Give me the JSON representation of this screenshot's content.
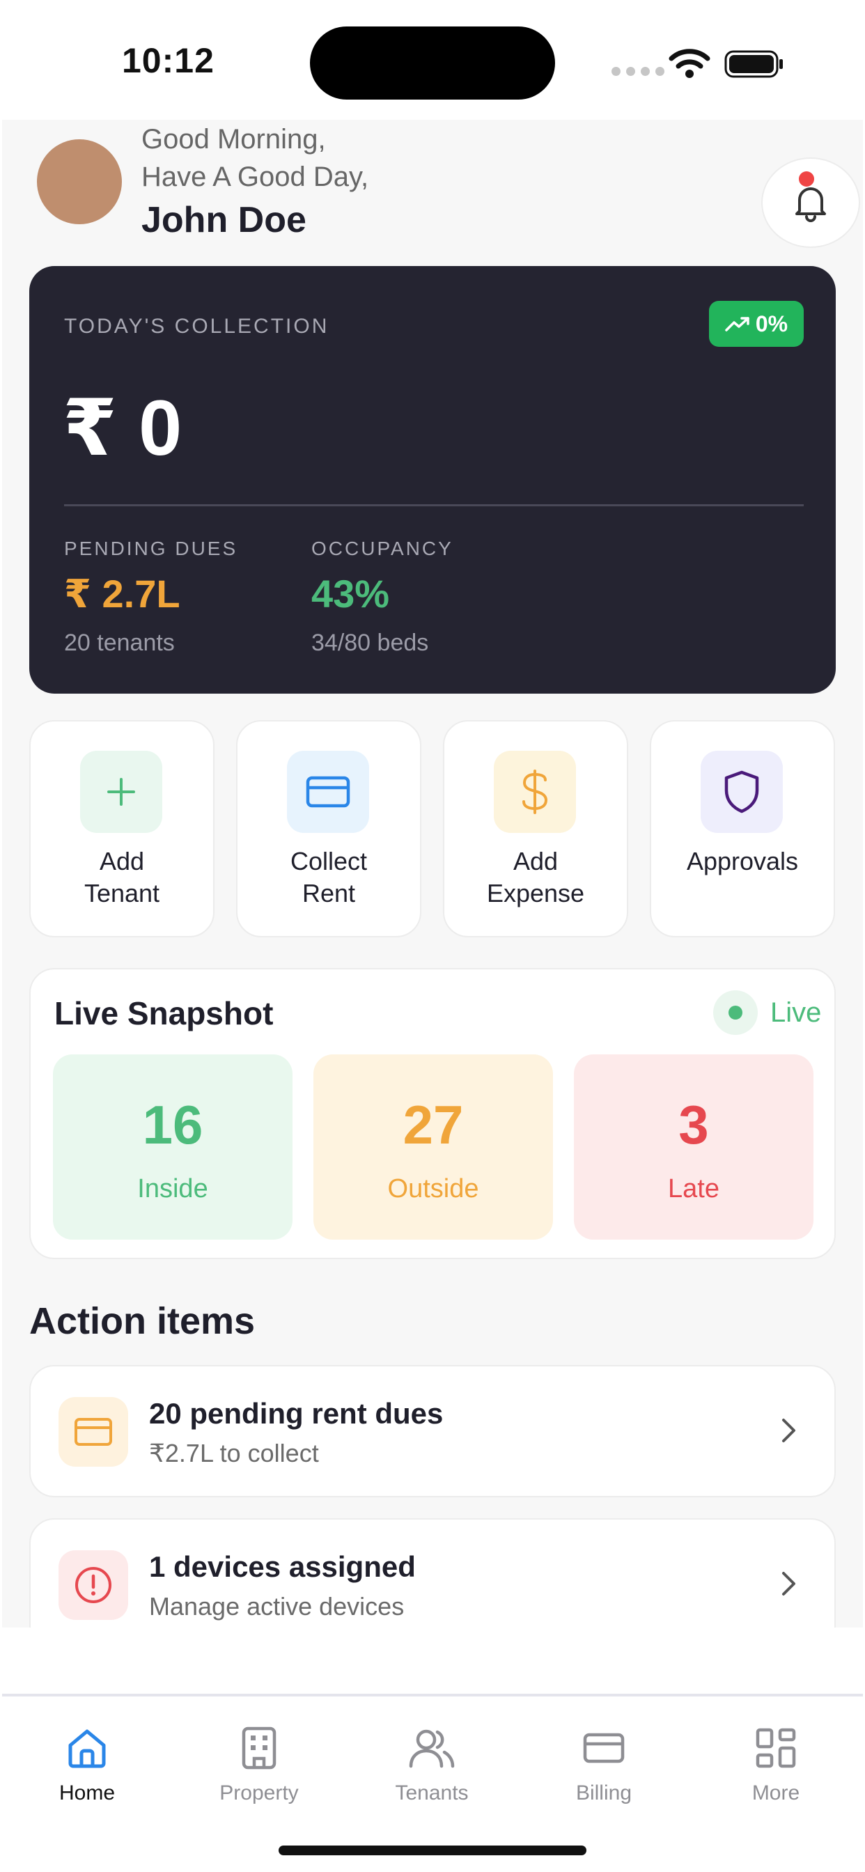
{
  "status_bar": {
    "time": "10:12",
    "icons": [
      "cellular-signal-icon",
      "wifi-icon",
      "battery-icon"
    ]
  },
  "header": {
    "greeting_line1": "Good Morning,",
    "greeting_line2": "Have A Good Day,",
    "user_name": "John Doe",
    "avatar_color": "#bf8e6e",
    "notification_icon": "bell-icon",
    "has_unread_notification": true
  },
  "collection_card": {
    "title": "TODAY'S COLLECTION",
    "trend_label": "0%",
    "trend_icon": "trending-up-icon",
    "amount": "₹ 0",
    "pending_dues": {
      "label": "PENDING DUES",
      "value": "₹ 2.7L",
      "sub": "20 tenants",
      "color": "#f0a53a"
    },
    "occupancy": {
      "label": "OCCUPANCY",
      "value": "43%",
      "sub": "34/80 beds",
      "color": "#4cbb7b"
    }
  },
  "quick_actions": [
    {
      "line1": "Add",
      "line2": "Tenant",
      "icon": "plus-icon",
      "color": "#4cbb7b",
      "bg": "#e9f7ef"
    },
    {
      "line1": "Collect",
      "line2": "Rent",
      "icon": "credit-card-icon",
      "color": "#2a86e8",
      "bg": "#e7f3fd"
    },
    {
      "line1": "Add",
      "line2": "Expense",
      "icon": "dollar-icon",
      "color": "#f0a53a",
      "bg": "#fdf4dc"
    },
    {
      "line1": "Approvals",
      "line2": "",
      "icon": "shield-icon",
      "color": "#4a1a7a",
      "bg": "#eeeefc"
    }
  ],
  "live_snapshot": {
    "title": "Live Snapshot",
    "live_label": "Live",
    "stats": [
      {
        "value": "16",
        "label": "Inside",
        "color": "#4cbb7b",
        "bg": "#e9f8ee"
      },
      {
        "value": "27",
        "label": "Outside",
        "color": "#f0a53a",
        "bg": "#fef3df"
      },
      {
        "value": "3",
        "label": "Late",
        "color": "#e6484f",
        "bg": "#fdeaea"
      }
    ]
  },
  "action_items": {
    "title": "Action items",
    "items": [
      {
        "title": "20 pending rent dues",
        "subtitle": "₹2.7L to collect",
        "icon": "credit-card-icon",
        "color": "#f0a53a",
        "bg": "#fef2de"
      },
      {
        "title": "1 devices assigned",
        "subtitle": "Manage active devices",
        "icon": "alert-circle-icon",
        "color": "#e6484f",
        "bg": "#fdeaea"
      }
    ]
  },
  "tab_bar": {
    "active_color": "#2a86e8",
    "tabs": [
      {
        "label": "Home",
        "icon": "home-icon",
        "active": true
      },
      {
        "label": "Property",
        "icon": "building-icon",
        "active": false
      },
      {
        "label": "Tenants",
        "icon": "users-icon",
        "active": false
      },
      {
        "label": "Billing",
        "icon": "credit-card-icon",
        "active": false
      },
      {
        "label": "More",
        "icon": "grid-icon",
        "active": false
      }
    ]
  }
}
